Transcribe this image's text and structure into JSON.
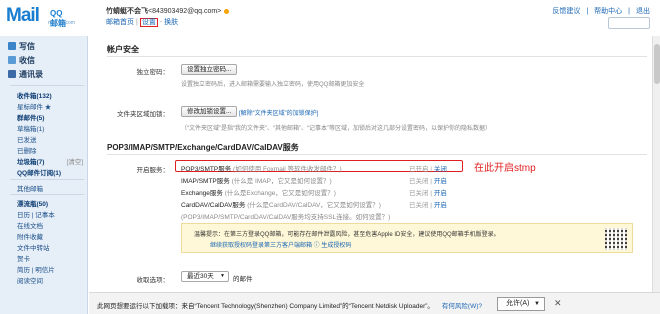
{
  "header": {
    "logo_text": "Mail",
    "logo_brand": "QQ邮箱",
    "logo_domain": "mail.qq.com",
    "user_name": "竹蜻蜓不会飞",
    "user_email": "<843903492@qq.com>",
    "links": [
      "邮箱首页",
      "设置",
      "换肤"
    ],
    "top_links": [
      "反馈建议",
      "帮助中心",
      "退出"
    ]
  },
  "sidebar": {
    "compose": "写信",
    "inbox": "收信",
    "contacts": "通讯录",
    "items": [
      {
        "label": "收件箱(132)",
        "bold": true
      },
      {
        "label": "星标邮件 ★",
        "bold": false
      },
      {
        "label": "群邮件(5)",
        "bold": true
      },
      {
        "label": "草稿箱(1)",
        "bold": false
      },
      {
        "label": "已发送",
        "bold": false
      },
      {
        "label": "已删除",
        "bold": false
      },
      {
        "label": "垃圾箱(7)",
        "bold": true,
        "extra": "[清空]"
      },
      {
        "label": "QQ邮件订阅(1)",
        "bold": true
      },
      {
        "label": "其他邮箱",
        "bold": false
      },
      {
        "label": "漂流瓶(50)",
        "bold": true
      },
      {
        "label": "日历 | 记事本",
        "bold": false
      },
      {
        "label": "在线文档",
        "bold": false
      },
      {
        "label": "附件收藏",
        "bold": false
      },
      {
        "label": "文件中转站",
        "bold": false
      },
      {
        "label": "贺卡",
        "bold": false
      },
      {
        "label": "简历 | 明信片",
        "bold": false
      },
      {
        "label": "阅读空间",
        "bold": false
      }
    ]
  },
  "account_security": {
    "title": "帐户安全",
    "standalone_label": "独立密码：",
    "standalone_button": "设置独立密码...",
    "standalone_note": "设置独立密码后，进入邮箱需要输入独立密码，使用QQ邮箱更加安全",
    "folder_label": "文件夹区域加锁：",
    "folder_button": "修改加锁设置...",
    "folder_link": "[解除“文件夹区域”的加锁保护]",
    "folder_note": "（“文件夹区域”是指“我的文件夹”、“其他邮箱”、“记事本”等区域，加锁后对这几部分设置密码，以保护你的隐私数据）"
  },
  "pop3": {
    "title": "POP3/IMAP/SMTP/Exchange/CardDAV/CalDAV服务",
    "open_label": "开启服务：",
    "services": [
      {
        "name": "POP3/SMTP服务",
        "hint": "(如何使用 Foxmail 等软件收发邮件？)",
        "status_off": "已开启",
        "status_on": "关闭"
      },
      {
        "name": "IMAP/SMTP服务",
        "hint": "(什么是 IMAP，它又是如何设置？)",
        "status_off": "已关闭",
        "status_on": "开启"
      },
      {
        "name": "Exchange服务",
        "hint": "(什么是Exchange，它又是如何设置？)",
        "status_off": "已关闭",
        "status_on": "开启"
      },
      {
        "name": "CardDAV/CalDAV服务",
        "hint": "(什么是CardDAV/CalDAV，它又是如何设置？)",
        "status_off": "已关闭",
        "status_on": "开启"
      },
      {
        "name": "(POP3/IMAP/SMTP/CardDAV/CalDAV服务均支持SSL连接。如何设置？)",
        "hint": "",
        "status_off": "",
        "status_on": ""
      }
    ],
    "annotation": "在此开启stmp",
    "warning_line1": "温馨提示：在第三方登录QQ邮箱，可能存在邮件泄露风险，甚至危害Apple ID安全，建议使用QQ邮箱手机版登录。",
    "warning_line2": "继续获取授权码登录第三方客户端邮箱 ⓘ 生成授权码"
  },
  "receive": {
    "label": "收取选项：",
    "select_value": "最近30天",
    "suffix": "的邮件"
  },
  "download_bar": {
    "message": "此网页想要运行以下加载项：来自“Tencent Technology(Shenzhen) Company Limited”的“Tencent Netdisk Uploader”。",
    "risk_link": "有何风险(W)?",
    "allow_button": "允许(A)",
    "colors": {
      "accent": "#1a7ed0",
      "highlight": "#e02020"
    }
  }
}
